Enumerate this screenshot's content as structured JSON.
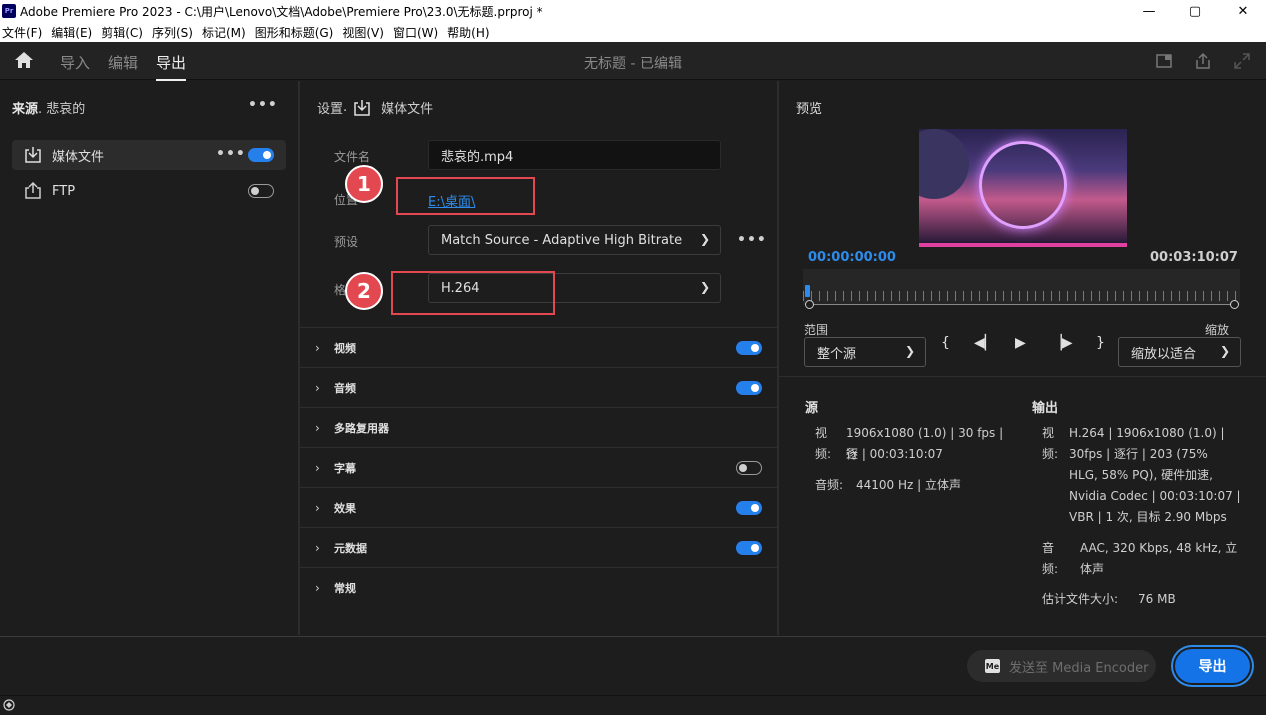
{
  "titlebar": {
    "app_icon": "Pr",
    "title": "Adobe Premiere Pro 2023 - C:\\用户\\Lenovo\\文档\\Adobe\\Premiere Pro\\23.0\\无标题.prproj *",
    "minimize": "—",
    "maximize": "▢",
    "close": "✕"
  },
  "menubar": [
    "文件(F)",
    "编辑(E)",
    "剪辑(C)",
    "序列(S)",
    "标记(M)",
    "图形和标题(G)",
    "视图(V)",
    "窗口(W)",
    "帮助(H)"
  ],
  "topnav": {
    "tabs": [
      "导入",
      "编辑",
      "导出"
    ],
    "active_tab": "导出",
    "project_title": "无标题 - 已编辑"
  },
  "source": {
    "label": "来源",
    "name": "悲哀的",
    "items": [
      {
        "label": "媒体文件",
        "enabled": true,
        "selected": true
      },
      {
        "label": "FTP",
        "enabled": false,
        "selected": false
      }
    ]
  },
  "settings": {
    "label": "设置",
    "target": "媒体文件",
    "filename_label": "文件名",
    "filename": "悲哀的.mp4",
    "location_label": "位置",
    "location": "E:\\桌面\\",
    "preset_label": "预设",
    "preset": "Match Source - Adaptive High Bitrate",
    "format_label": "格式",
    "format": "H.264",
    "annotations": [
      "1",
      "2"
    ],
    "sections": [
      {
        "label": "视频",
        "toggle": "on"
      },
      {
        "label": "音频",
        "toggle": "on"
      },
      {
        "label": "多路复用器",
        "toggle": "none"
      },
      {
        "label": "字幕",
        "toggle": "off"
      },
      {
        "label": "效果",
        "toggle": "on"
      },
      {
        "label": "元数据",
        "toggle": "on"
      },
      {
        "label": "常规",
        "toggle": "none"
      }
    ]
  },
  "preview": {
    "label": "预览",
    "timecode_start": "00:00:00:00",
    "timecode_end": "00:03:10:07",
    "range_label": "范围",
    "range_value": "整个源",
    "zoom_label": "缩放",
    "zoom_value": "缩放以适合"
  },
  "source_info": {
    "label": "源",
    "video_key": "视频:",
    "video_lines": [
      "1906x1080 (1.0) | 30 fps | 逐",
      "行 | 00:03:10:07"
    ],
    "audio_key": "音频:",
    "audio": "44100 Hz | 立体声"
  },
  "output_info": {
    "label": "输出",
    "video_key": "视频:",
    "video_lines": [
      "H.264 | 1906x1080 (1.0) |",
      "30fps | 逐行 | 203 (75%",
      "HLG, 58% PQ), 硬件加速,",
      "Nvidia Codec | 00:03:10:07 |",
      "VBR | 1 次, 目标 2.90 Mbps"
    ],
    "audio_key": "音频:",
    "audio_lines": [
      "AAC, 320 Kbps, 48 kHz, 立",
      "体声"
    ],
    "size_label": "估计文件大小:",
    "size_value": "76 MB"
  },
  "footer": {
    "send_label": "发送至 Media Encoder",
    "me_icon": "Me",
    "export_label": "导出"
  },
  "colors": {
    "accent": "#1473e6",
    "link": "#2d8ceb",
    "annotation": "#e34850"
  }
}
